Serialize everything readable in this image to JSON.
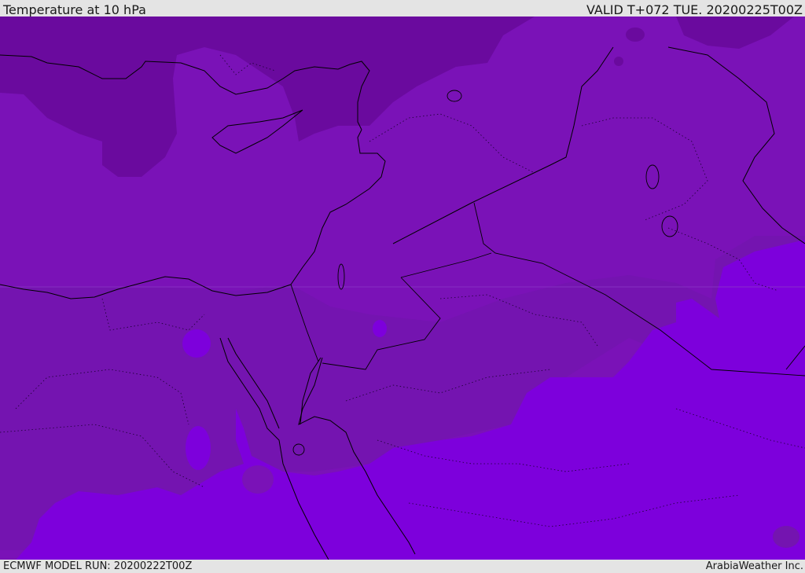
{
  "header": {
    "title": "Temperature at 10 hPa",
    "valid": "VALID T+072 TUE. 20200225T00Z"
  },
  "footer": {
    "model_run": "ECMWF MODEL RUN: 20200222T00Z",
    "credit": "ArabiaWeather Inc."
  },
  "colors": {
    "background_shade": "#7a12b7",
    "dark_shade": "#6a0a9e",
    "mid_shade": "#7414b0",
    "bright_shade": "#7d00dc",
    "coastline": "#000000",
    "bar_background": "#e4e4e4"
  }
}
